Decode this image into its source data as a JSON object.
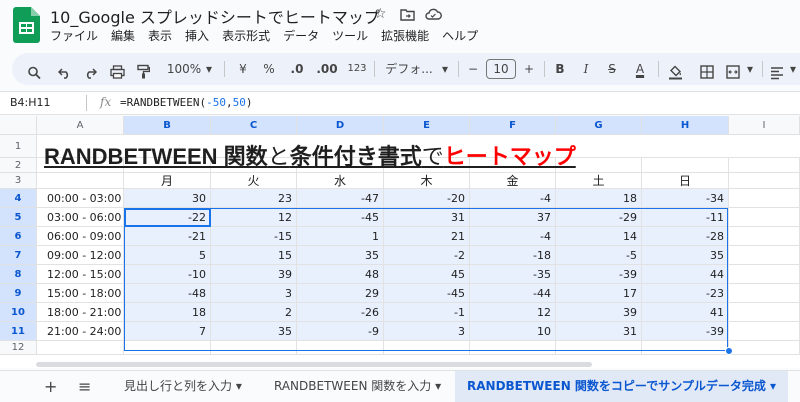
{
  "doc": {
    "title": "10_Google スプレッドシートでヒートマップ"
  },
  "menu": [
    "ファイル",
    "編集",
    "表示",
    "挿入",
    "表示形式",
    "データ",
    "ツール",
    "拡張機能",
    "ヘルプ"
  ],
  "toolbar": {
    "zoom": "100%",
    "currency": "¥",
    "percent": "%",
    "dec_dec": ".0",
    "dec_inc": ".00",
    "format_123": "123",
    "font": "デフォ...",
    "font_size": "10",
    "minus": "−",
    "plus": "+",
    "bold": "B",
    "italic": "I",
    "strike": "S",
    "text_color": "A"
  },
  "formula_bar": {
    "cell_ref": "B4:H11",
    "fx": "fx",
    "formula_prefix": "=RANDBETWEEN(",
    "formula_arg1": "-50",
    "formula_comma": ",",
    "formula_arg2": "50",
    "formula_suffix": ")"
  },
  "sheet": {
    "col_headers": [
      "A",
      "B",
      "C",
      "D",
      "E",
      "F",
      "G",
      "H",
      "I"
    ],
    "row_headers": [
      "1",
      "2",
      "3",
      "4",
      "5",
      "6",
      "7",
      "8",
      "9",
      "10",
      "11",
      "12"
    ],
    "title_parts": [
      "RANDBETWEEN 関数",
      "と",
      "条件付き書式",
      "で",
      "ヒートマップ"
    ],
    "day_headers": [
      "月",
      "火",
      "水",
      "木",
      "金",
      "土",
      "日"
    ],
    "rows": [
      {
        "time": "00:00 - 03:00",
        "values": [
          "30",
          "23",
          "-47",
          "-20",
          "-4",
          "18",
          "-34"
        ]
      },
      {
        "time": "03:00 - 06:00",
        "values": [
          "-22",
          "12",
          "-45",
          "31",
          "37",
          "-29",
          "-11"
        ]
      },
      {
        "time": "06:00 - 09:00",
        "values": [
          "-21",
          "-15",
          "1",
          "21",
          "-4",
          "14",
          "-28"
        ]
      },
      {
        "time": "09:00 - 12:00",
        "values": [
          "5",
          "15",
          "35",
          "-2",
          "-18",
          "-5",
          "35"
        ]
      },
      {
        "time": "12:00 - 15:00",
        "values": [
          "-10",
          "39",
          "48",
          "45",
          "-35",
          "-39",
          "44"
        ]
      },
      {
        "time": "15:00 - 18:00",
        "values": [
          "-48",
          "3",
          "29",
          "-45",
          "-44",
          "17",
          "-23"
        ]
      },
      {
        "time": "18:00 - 21:00",
        "values": [
          "18",
          "2",
          "-26",
          "-1",
          "12",
          "39",
          "41"
        ]
      },
      {
        "time": "21:00 - 24:00",
        "values": [
          "7",
          "35",
          "-9",
          "3",
          "10",
          "31",
          "-39"
        ]
      }
    ]
  },
  "sheet_tabs": {
    "add": "+",
    "list": "≡",
    "tabs": [
      "見出し行と列を入力",
      "RANDBETWEEN 関数を入力",
      "RANDBETWEEN 関数をコピーでサンプルデータ完成"
    ],
    "arrow": "▾"
  },
  "icons": [
    "sheets-logo",
    "star-icon",
    "move-folder-icon",
    "cloud-icon",
    "search-icon",
    "undo-icon",
    "redo-icon",
    "print-icon",
    "paint-format-icon",
    "fill-color-icon",
    "borders-icon",
    "merge-icon",
    "align-icon"
  ],
  "colors": {
    "accent": "#1a73e8",
    "selection": "#e8f0fe",
    "header_selected": "#d3e3fd",
    "title_red": "#ff0000",
    "sheets_green": "#0f9d58"
  }
}
